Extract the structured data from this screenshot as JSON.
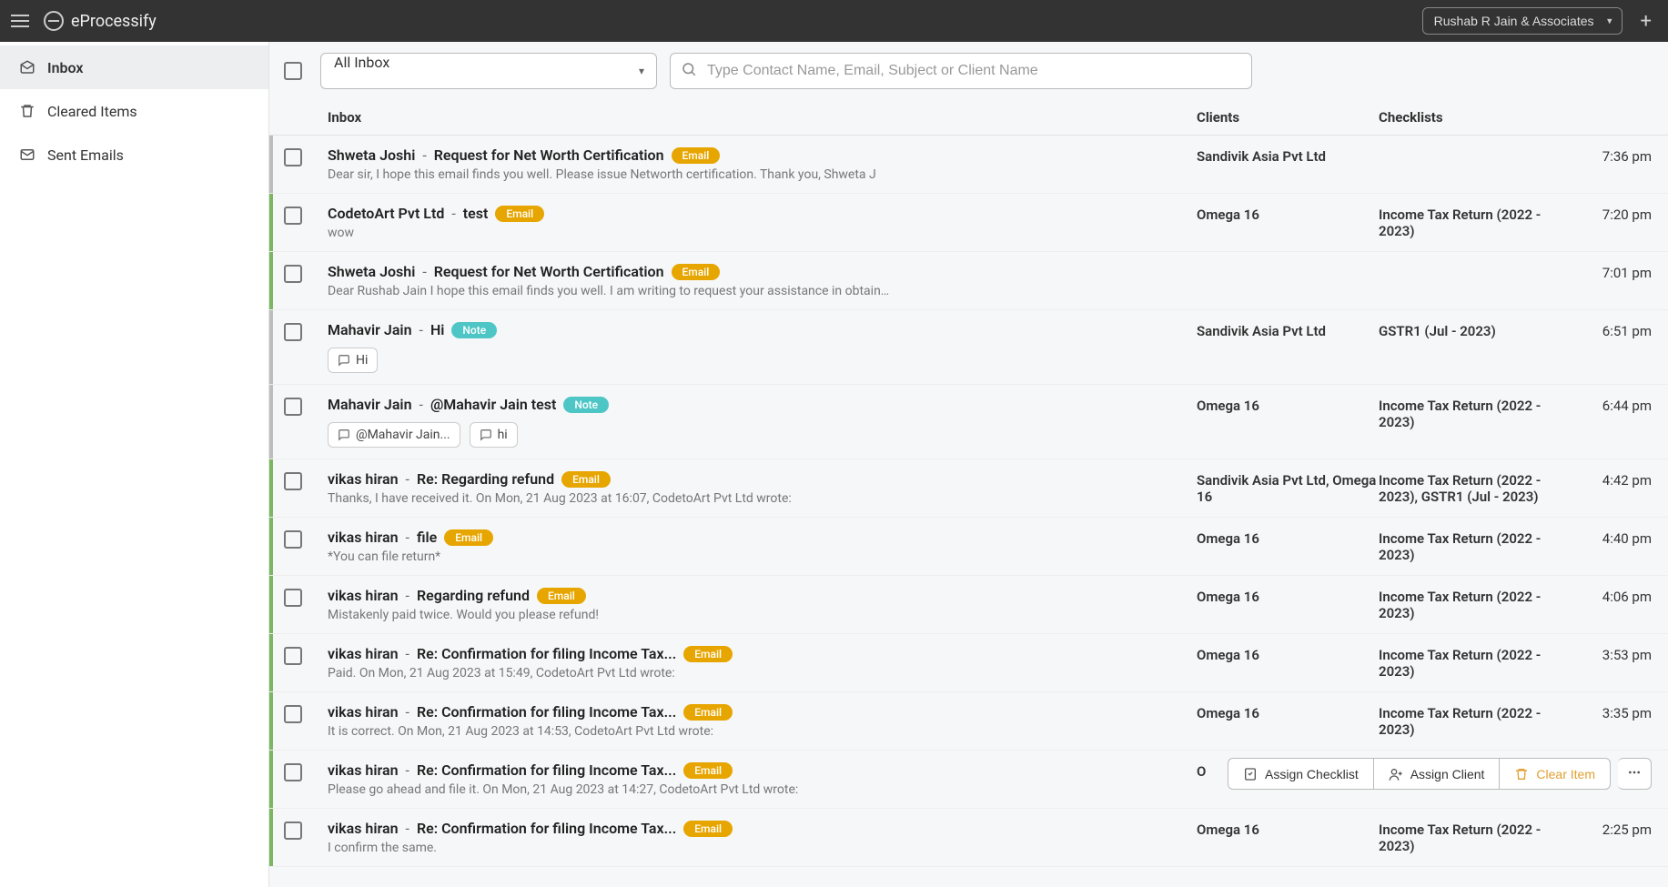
{
  "app": {
    "name": "eProcessify"
  },
  "account": {
    "name": "Rushab R Jain & Associates"
  },
  "sidebar": {
    "items": [
      {
        "label": "Inbox",
        "icon": "inbox-icon",
        "active": true
      },
      {
        "label": "Cleared Items",
        "icon": "trash-icon",
        "active": false
      },
      {
        "label": "Sent Emails",
        "icon": "sent-icon",
        "active": false
      }
    ]
  },
  "filters": {
    "dropdown_value": "All Inbox",
    "search_placeholder": "Type Contact Name, Email, Subject or Client Name"
  },
  "columns": {
    "inbox": "Inbox",
    "clients": "Clients",
    "checklists": "Checklists"
  },
  "ghost_tip": "",
  "hover_actions": {
    "assign_checklist": "Assign Checklist",
    "assign_client": "Assign Client",
    "clear_item": "Clear Item"
  },
  "rows": [
    {
      "sender": "Shweta Joshi",
      "subject": "Request for Net Worth Certification",
      "badge": "Email",
      "badge_type": "email",
      "preview": "Dear sir, I hope this email finds you well. Please issue Networth certification. Thank you, Shweta J",
      "clients": "Sandivik Asia Pvt Ltd",
      "checklists": "",
      "time": "7:36 pm",
      "stripe": "grey"
    },
    {
      "sender": "CodetoArt Pvt Ltd",
      "subject": "test",
      "badge": "Email",
      "badge_type": "email",
      "preview": "wow",
      "clients": "Omega 16",
      "checklists": "Income Tax Return (2022 - 2023)",
      "time": "7:20 pm",
      "stripe": "green"
    },
    {
      "sender": "Shweta Joshi",
      "subject": "Request for Net Worth Certification",
      "badge": "Email",
      "badge_type": "email",
      "preview": "Dear Rushab Jain I hope this email finds you well. I am writing to request your assistance in obtaini...",
      "clients": "",
      "checklists": "",
      "time": "7:01 pm",
      "stripe": "green"
    },
    {
      "sender": "Mahavir Jain",
      "subject": "Hi",
      "badge": "Note",
      "badge_type": "note",
      "preview": "",
      "chips": [
        "Hi"
      ],
      "clients": "Sandivik Asia Pvt Ltd",
      "checklists": "GSTR1 (Jul - 2023)",
      "time": "6:51 pm",
      "stripe": "grey"
    },
    {
      "sender": "Mahavir Jain",
      "subject": "@Mahavir Jain  test",
      "badge": "Note",
      "badge_type": "note",
      "preview": "",
      "chips": [
        "@Mahavir Jain...",
        "hi"
      ],
      "clients": "Omega 16",
      "checklists": "Income Tax Return (2022 - 2023)",
      "time": "6:44 pm",
      "stripe": "grey"
    },
    {
      "sender": "vikas hiran",
      "subject": "Re: Regarding refund",
      "badge": "Email",
      "badge_type": "email",
      "preview": "Thanks, I have received it. On Mon, 21 Aug 2023 at 16:07, CodetoArt Pvt Ltd wrote:",
      "clients": "Sandivik Asia Pvt Ltd, Omega 16",
      "checklists": "Income Tax Return (2022 - 2023), GSTR1 (Jul - 2023)",
      "time": "4:42 pm",
      "stripe": "green"
    },
    {
      "sender": "vikas hiran",
      "subject": "file",
      "badge": "Email",
      "badge_type": "email",
      "preview": "*You can file return*",
      "clients": "Omega 16",
      "checklists": "Income Tax Return (2022 - 2023)",
      "time": "4:40 pm",
      "stripe": "green"
    },
    {
      "sender": "vikas hiran",
      "subject": "Regarding refund",
      "badge": "Email",
      "badge_type": "email",
      "preview": "Mistakenly paid twice. Would you please refund!",
      "clients": "Omega 16",
      "checklists": "Income Tax Return (2022 - 2023)",
      "time": "4:06 pm",
      "stripe": "green"
    },
    {
      "sender": "vikas hiran",
      "subject": "Re: Confirmation for filing Income Tax...",
      "badge": "Email",
      "badge_type": "email",
      "preview": "Paid. On Mon, 21 Aug 2023 at 15:49, CodetoArt Pvt Ltd wrote:",
      "clients": "Omega 16",
      "checklists": "Income Tax Return (2022 - 2023)",
      "time": "3:53 pm",
      "stripe": "green"
    },
    {
      "sender": "vikas hiran",
      "subject": "Re: Confirmation for filing Income Tax...",
      "badge": "Email",
      "badge_type": "email",
      "preview": "It is correct. On Mon, 21 Aug 2023 at 14:53, CodetoArt Pvt Ltd wrote:",
      "clients": "Omega 16",
      "checklists": "Income Tax Return (2022 - 2023)",
      "time": "3:35 pm",
      "stripe": "green"
    },
    {
      "sender": "vikas hiran",
      "subject": "Re: Confirmation for filing Income Tax...",
      "badge": "Email",
      "badge_type": "email",
      "preview": "Please go ahead and file it. On Mon, 21 Aug 2023 at 14:27, CodetoArt Pvt Ltd wrote:",
      "clients": "O",
      "checklists": "",
      "time": "",
      "stripe": "green",
      "show_hover": true
    },
    {
      "sender": "vikas hiran",
      "subject": "Re: Confirmation for filing Income Tax...",
      "badge": "Email",
      "badge_type": "email",
      "preview": "I confirm the same.",
      "clients": "Omega 16",
      "checklists": "Income Tax Return (2022 - 2023)",
      "time": "2:25 pm",
      "stripe": "green"
    }
  ]
}
